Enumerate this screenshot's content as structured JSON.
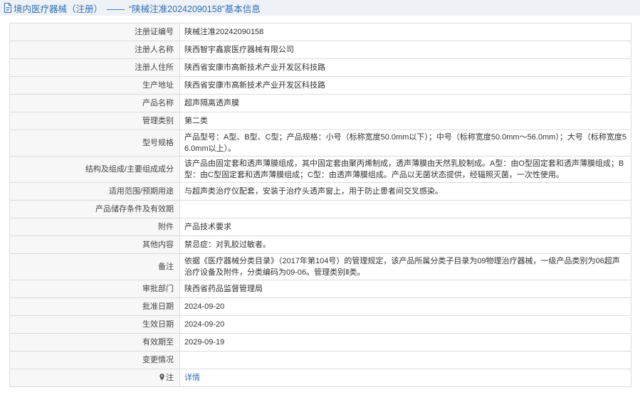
{
  "header": {
    "category": "境内医疗器械（注册）",
    "separator": "——",
    "record_title": "“陕械注准20242090158”基本信息"
  },
  "rows": [
    {
      "label": "注册证编号",
      "value": "陕械注准20242090158"
    },
    {
      "label": "注册人名称",
      "value": "陕西智宇鑫宸医疗器械有限公司"
    },
    {
      "label": "注册人住所",
      "value": "陕西省安康市高新技术产业开发区科技路"
    },
    {
      "label": "生产地址",
      "value": "陕西省安康市高新技术产业开发区科技路"
    },
    {
      "label": "产品名称",
      "value": "超声隔离透声膜"
    },
    {
      "label": "管理类别",
      "value": "第二类"
    },
    {
      "label": "型号规格",
      "value": "产品型号：A型、B型、C型；产品规格：小号（标称宽度50.0mm以下）；中号（标称宽度50.0mm～56.0mm）；大号（标称宽度56.0mm以上）。"
    },
    {
      "label": "结构及组成/主要组成成分",
      "value": "该产品由固定套和透声薄膜组成，其中固定套由聚丙烯制成，透声薄膜由天然乳胶制成。A型：由O型固定套和透声薄膜组成；B型：由C型固定套和透声薄膜组成；C型：由透声薄膜组成。产品以无菌状态提供，经辐照灭菌，一次性使用。"
    },
    {
      "label": "适用范围/预期用途",
      "value": "与超声类治疗仪配套，安装于治疗头透声窗上，用于防止患者间交叉感染。"
    },
    {
      "label": "产品储存条件及有效期",
      "value": ""
    },
    {
      "label": "附件",
      "value": "产品技术要求"
    },
    {
      "label": "其他内容",
      "value": "禁忌症：对乳胶过敏者。"
    },
    {
      "label": "备注",
      "value": "依据《医疗器械分类目录》（2017年第104号）的管理规定，该产品所属分类子目录为09物理治疗器械，一级产品类别为06超声治疗设备及附件，分类编码为09-06。管理类别Ⅱ类。"
    },
    {
      "label": "审批部门",
      "value": "陕西省药品监督管理局"
    },
    {
      "label": "批准日期",
      "value": "2024-09-20"
    },
    {
      "label": "生效日期",
      "value": "2024-09-20"
    },
    {
      "label": "有效期至",
      "value": "2029-09-19"
    },
    {
      "label": "变更情况",
      "value": ""
    }
  ],
  "note_row": {
    "label": "注",
    "link_text": "详情"
  },
  "colors": {
    "header_bg": "#eef1f5",
    "link": "#2f6fb7",
    "label_bg": "#f7f7f7",
    "border": "#dcdcdc"
  },
  "icons": {
    "header": "document-icon",
    "note": "map-pin-icon"
  }
}
